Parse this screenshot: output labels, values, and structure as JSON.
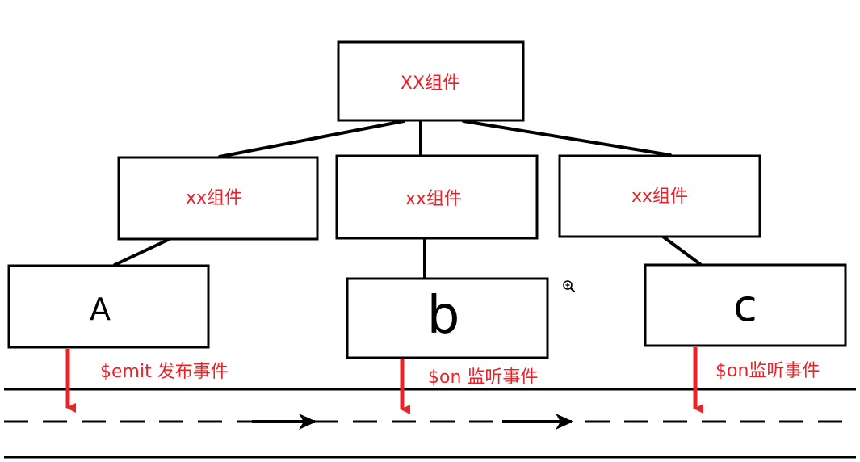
{
  "nodes": {
    "root": {
      "label": "XX组件"
    },
    "mid_left": {
      "label": "xx组件"
    },
    "mid_center": {
      "label": "xx组件"
    },
    "mid_right": {
      "label": "xx组件"
    },
    "leaf_a": {
      "label": "A"
    },
    "leaf_b": {
      "label": "b"
    },
    "leaf_c": {
      "label": "c"
    }
  },
  "events": {
    "emit": {
      "label": "$emit 发布事件"
    },
    "on_b": {
      "label": "$on 监听事件"
    },
    "on_c": {
      "label": "$on监听事件"
    }
  },
  "colors": {
    "accent_red": "#e8232a",
    "stroke": "#000000",
    "background": "#ffffff"
  },
  "icons": {
    "cursor": "zoom-in-icon"
  }
}
